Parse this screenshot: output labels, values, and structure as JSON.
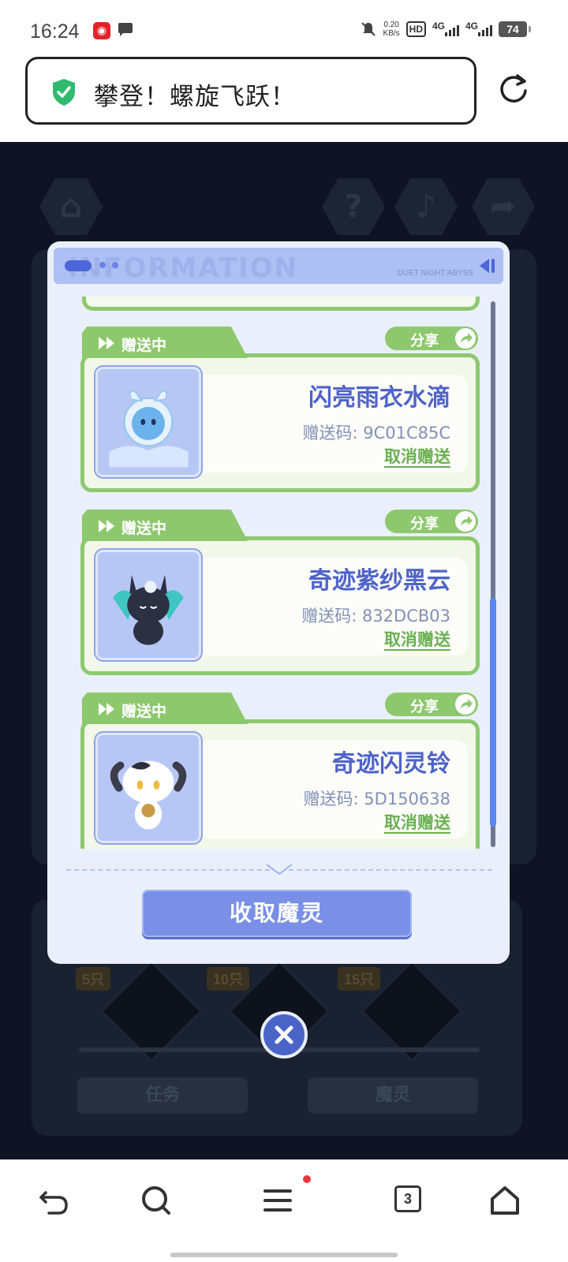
{
  "status_bar": {
    "time": "16:24",
    "net_speed_value": "0.20",
    "net_speed_unit": "KB/s",
    "hd_label": "HD",
    "signal_1": "4G",
    "signal_2": "4G",
    "battery": "74"
  },
  "address_bar": {
    "title": "攀登！螺旋飞跃！"
  },
  "background": {
    "badges": [
      "5只",
      "10只",
      "15只"
    ],
    "tabs": [
      "任务",
      "魔灵"
    ]
  },
  "modal": {
    "header_watermark": "INFORMATION",
    "header_brand": "DUET NIGHT ABYSS",
    "items": [
      {
        "status": "赠送中",
        "share_label": "分享",
        "name": "闪亮雨衣水滴",
        "code_label": "赠送码: 9C01C85C",
        "cancel_label": "取消赠送"
      },
      {
        "status": "赠送中",
        "share_label": "分享",
        "name": "奇迹紫纱黑云",
        "code_label": "赠送码: 832DCB03",
        "cancel_label": "取消赠送"
      },
      {
        "status": "赠送中",
        "share_label": "分享",
        "name": "奇迹闪灵铃",
        "code_label": "赠送码: 5D150638",
        "cancel_label": "取消赠送"
      }
    ],
    "collect_button": "收取魔灵"
  },
  "bottom_nav": {
    "tab_count": "3"
  },
  "colors": {
    "accent_green": "#8ec86e",
    "accent_blue": "#7a90e6",
    "name_blue": "#4f63c9"
  }
}
